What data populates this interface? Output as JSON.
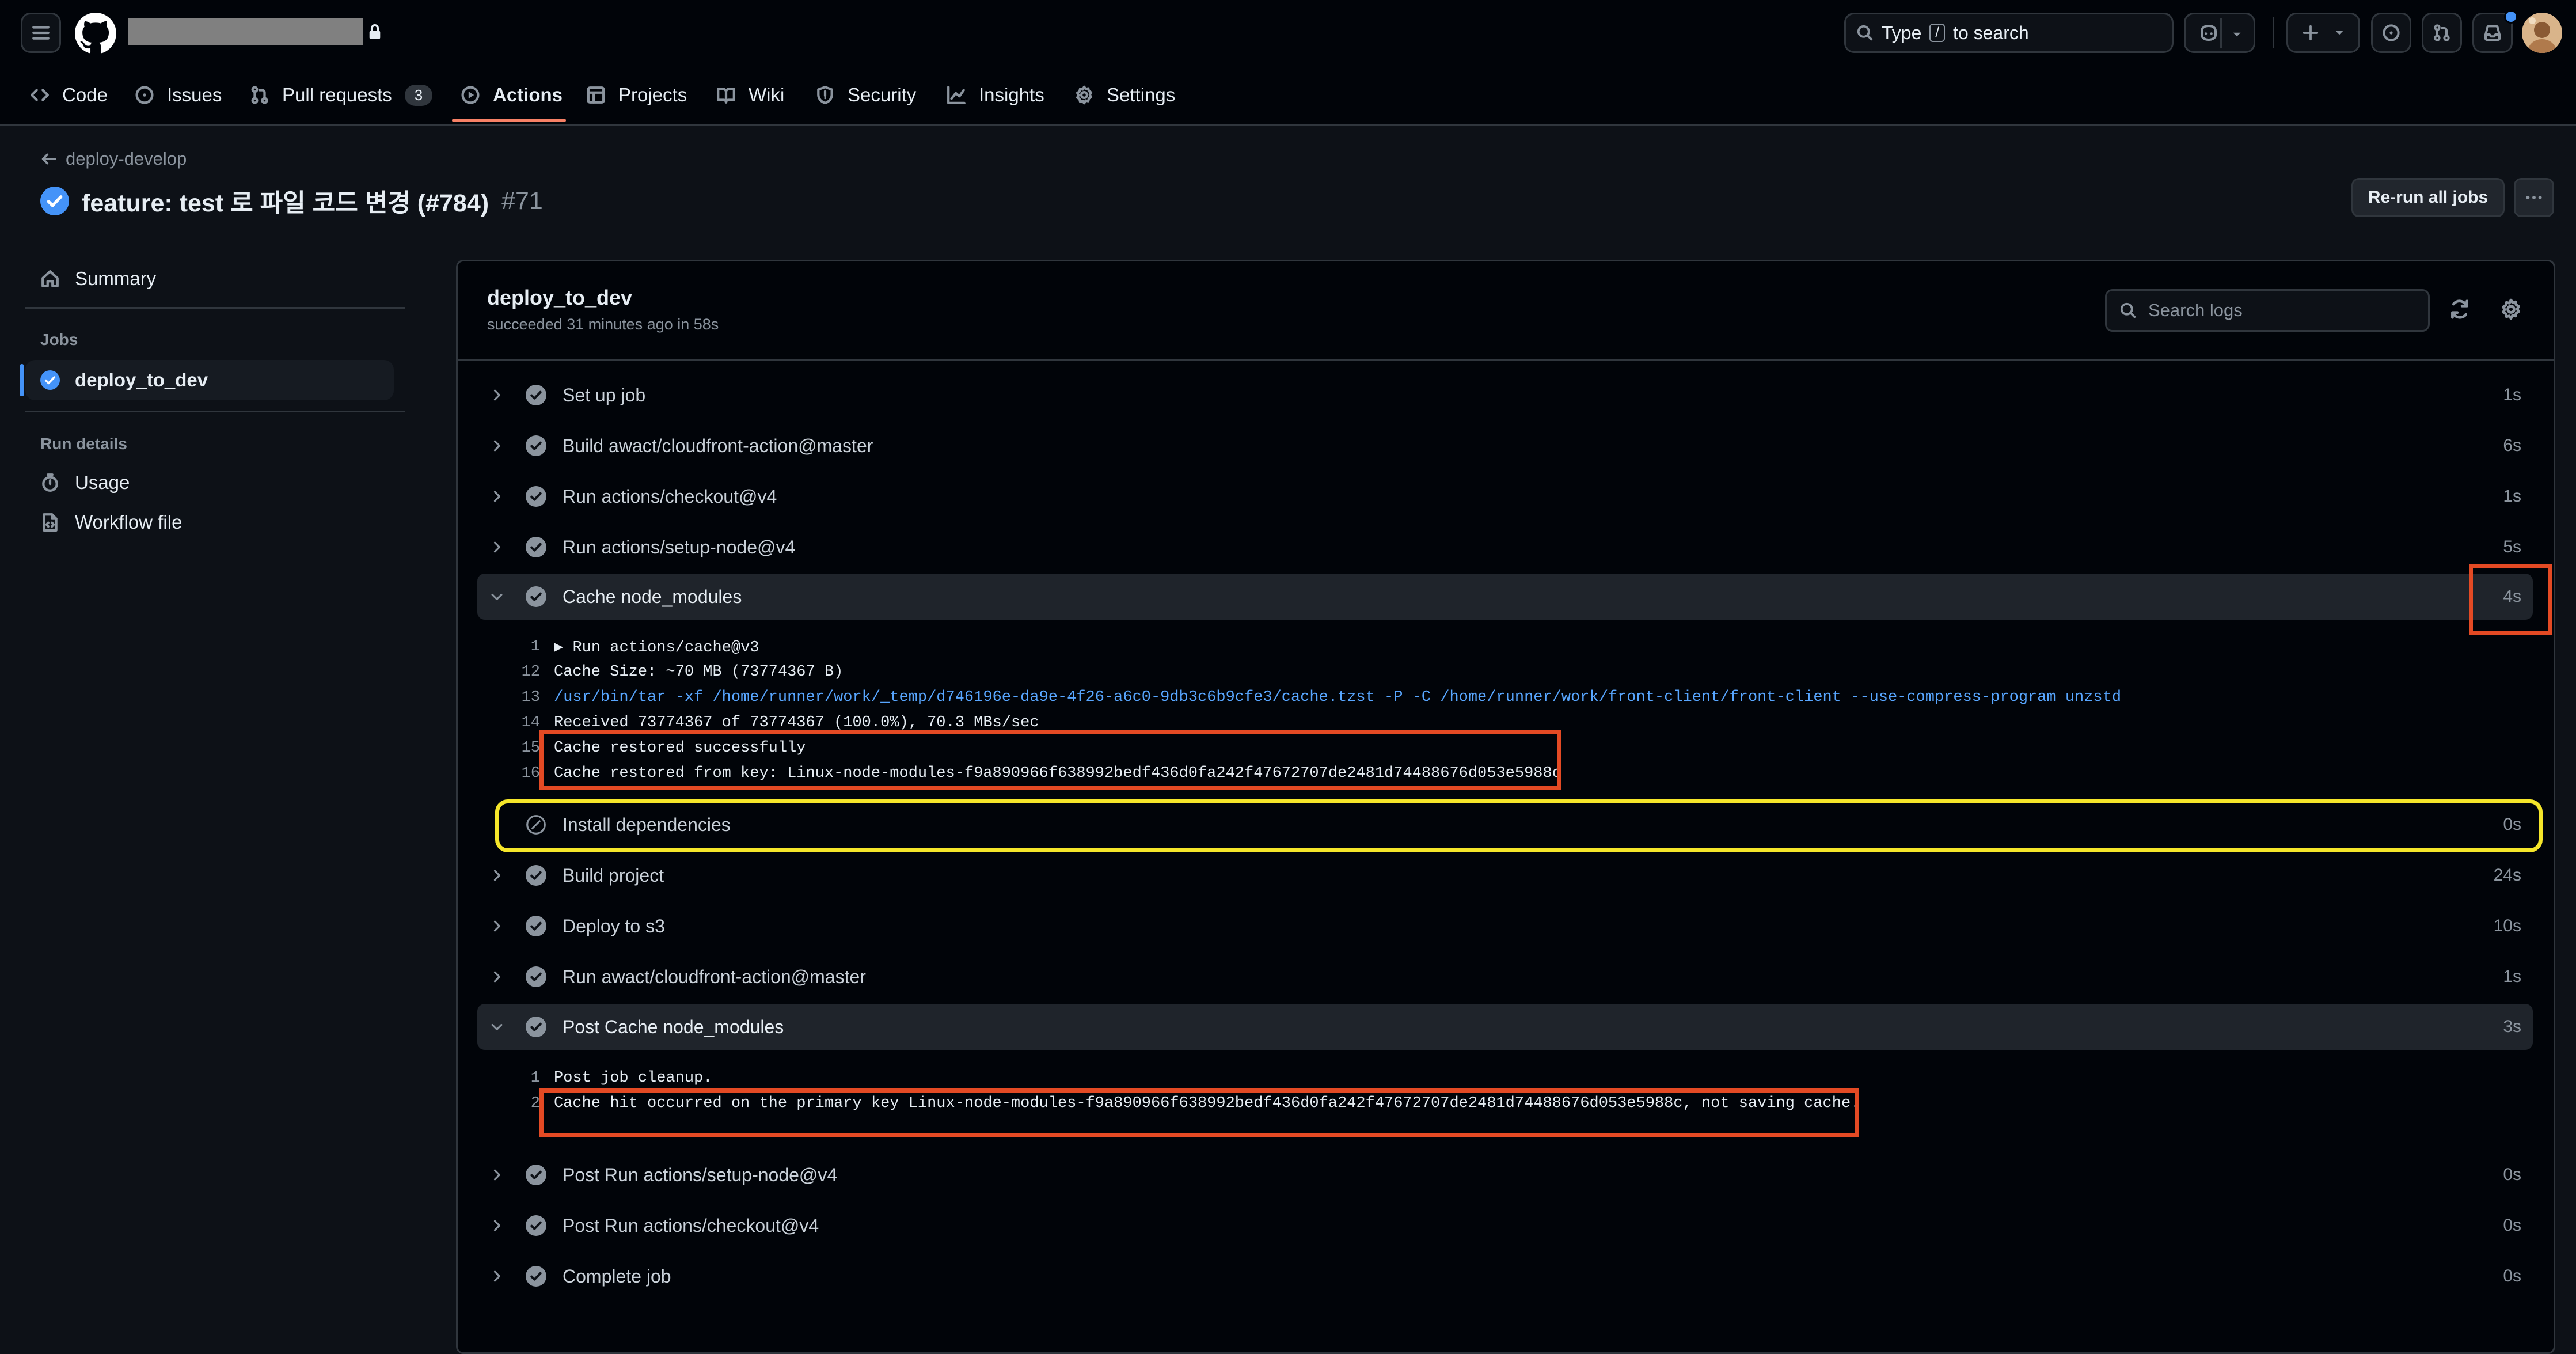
{
  "header": {
    "search_prefix": "Type",
    "search_key": "/",
    "search_suffix": "to search"
  },
  "tabs": [
    {
      "label": "Code",
      "icon": "code-icon"
    },
    {
      "label": "Issues",
      "icon": "issue-icon"
    },
    {
      "label": "Pull requests",
      "icon": "pull-request-icon",
      "count": "3"
    },
    {
      "label": "Actions",
      "icon": "play-icon",
      "selected": true
    },
    {
      "label": "Projects",
      "icon": "table-icon"
    },
    {
      "label": "Wiki",
      "icon": "book-icon"
    },
    {
      "label": "Security",
      "icon": "shield-icon"
    },
    {
      "label": "Insights",
      "icon": "graph-icon"
    },
    {
      "label": "Settings",
      "icon": "gear-icon"
    }
  ],
  "run": {
    "back_label": "deploy-develop",
    "title": "feature: test 로 파일 코드 변경 (#784)",
    "number": "#71",
    "rerun_label": "Re-run all jobs"
  },
  "sidebar": {
    "summary": "Summary",
    "jobs_heading": "Jobs",
    "job": "deploy_to_dev",
    "run_details_heading": "Run details",
    "usage": "Usage",
    "workflow_file": "Workflow file"
  },
  "job": {
    "name": "deploy_to_dev",
    "status": "succeeded 31 minutes ago in 58s",
    "search_placeholder": "Search logs"
  },
  "steps": [
    {
      "name": "Set up job",
      "duration": "1s",
      "state": "success"
    },
    {
      "name": "Build awact/cloudfront-action@master",
      "duration": "6s",
      "state": "success"
    },
    {
      "name": "Run actions/checkout@v4",
      "duration": "1s",
      "state": "success"
    },
    {
      "name": "Run actions/setup-node@v4",
      "duration": "5s",
      "state": "success"
    },
    {
      "name": "Cache node_modules",
      "duration": "4s",
      "state": "success",
      "expanded": true
    },
    {
      "name": "Install dependencies",
      "duration": "0s",
      "state": "skipped"
    },
    {
      "name": "Build project",
      "duration": "24s",
      "state": "success"
    },
    {
      "name": "Deploy to s3",
      "duration": "10s",
      "state": "success"
    },
    {
      "name": "Run awact/cloudfront-action@master",
      "duration": "1s",
      "state": "success"
    },
    {
      "name": "Post Cache node_modules",
      "duration": "3s",
      "state": "success",
      "expanded": true
    },
    {
      "name": "Post Run actions/setup-node@v4",
      "duration": "0s",
      "state": "success"
    },
    {
      "name": "Post Run actions/checkout@v4",
      "duration": "0s",
      "state": "success"
    },
    {
      "name": "Complete job",
      "duration": "0s",
      "state": "success"
    }
  ],
  "cache_log": [
    {
      "ln": "1",
      "text": "▶ Run actions/cache@v3"
    },
    {
      "ln": "12",
      "text": "Cache Size: ~70 MB (73774367 B)"
    },
    {
      "ln": "13",
      "text": "/usr/bin/tar -xf /home/runner/work/_temp/d746196e-da9e-4f26-a6c0-9db3c6b9cfe3/cache.tzst -P -C /home/runner/work/front-client/front-client --use-compress-program unzstd"
    },
    {
      "ln": "14",
      "text": "Received 73774367 of 73774367 (100.0%), 70.3 MBs/sec"
    },
    {
      "ln": "15",
      "text": "Cache restored successfully"
    },
    {
      "ln": "16",
      "text": "Cache restored from key: Linux-node-modules-f9a890966f638992bedf436d0fa242f47672707de2481d74488676d053e5988c"
    }
  ],
  "post_cache_log": [
    {
      "ln": "1",
      "text": "Post job cleanup."
    },
    {
      "ln": "2",
      "text": "Cache hit occurred on the primary key Linux-node-modules-f9a890966f638992bedf436d0fa242f47672707de2481d74488676d053e5988c, not saving cache."
    }
  ],
  "colors": {
    "background": "#0d1117",
    "accent_tab": "#f78166",
    "success_blue": "#4493f8",
    "annotation_red": "#e34a24",
    "annotation_yellow": "#f5e62a"
  }
}
